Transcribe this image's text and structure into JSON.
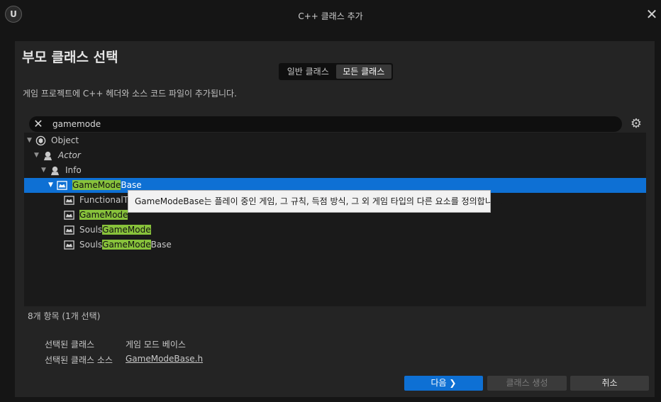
{
  "window": {
    "title": "C++ 클래스 추가",
    "logo_text": "U"
  },
  "panel": {
    "heading": "부모 클래스 선택",
    "tabs": [
      {
        "label": "일반 클래스",
        "active": false
      },
      {
        "label": "모든 클래스",
        "active": true
      }
    ],
    "description": "게임 프로젝트에 C++ 헤더와 소스 코드 파일이 추가됩니다."
  },
  "search": {
    "value": "gamemode",
    "clear_icon": "close-icon",
    "settings_icon": "gear-icon"
  },
  "tree": {
    "items": [
      {
        "pre": "Object",
        "hl": "",
        "post": "",
        "icon": "object-icon"
      },
      {
        "pre": "Actor",
        "hl": "",
        "post": "",
        "icon": "actor-icon"
      },
      {
        "pre": "Info",
        "hl": "",
        "post": "",
        "icon": "actor-icon"
      },
      {
        "pre": "",
        "hl": "GameMode",
        "post": "Base",
        "icon": "gamepad-icon"
      },
      {
        "pre": "FunctionalT",
        "hl": "",
        "post": "",
        "icon": "gamepad-icon"
      },
      {
        "pre": "",
        "hl": "GameMode",
        "post": "",
        "icon": "gamepad-icon"
      },
      {
        "pre": "Souls",
        "hl": "GameMode",
        "post": "",
        "icon": "gamepad-icon"
      },
      {
        "pre": "Souls",
        "hl": "GameMode",
        "post": "Base",
        "icon": "gamepad-icon"
      }
    ]
  },
  "tooltip": "GameModeBase는 플레이 중인 게임, 그 규칙, 득점 방식, 그 외 게임 타입의 다른 요소를 정의합니다.",
  "status": {
    "count": "8개 항목 (1개 선택)"
  },
  "selection": {
    "class_label": "선택된 클래스",
    "class_value": "게임 모드 베이스",
    "source_label": "선택된 클래스 소스",
    "source_value": "GameModeBase.h"
  },
  "buttons": {
    "next": "다음",
    "create": "클래스 생성",
    "cancel": "취소"
  },
  "colors": {
    "selection": "#0e70d4",
    "highlight": "#88c23b",
    "accent": "#0e70d4"
  }
}
